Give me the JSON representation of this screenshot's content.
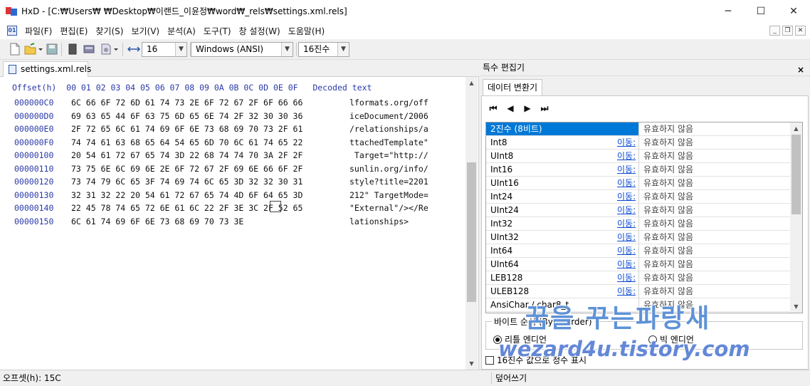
{
  "window": {
    "app_name": "HxD",
    "title": "HxD - [C:₩Users₩     ₩Desktop₩이랜드_이윤정₩word₩_rels₩settings.xml.rels]",
    "minimize": "─",
    "maximize": "☐",
    "close": "✕"
  },
  "menu": {
    "items": [
      "파일(F)",
      "편집(E)",
      "찾기(S)",
      "보기(V)",
      "분석(A)",
      "도구(T)",
      "창 설정(W)",
      "도움말(H)"
    ]
  },
  "toolbar": {
    "bytes_per_row": "16",
    "charset": "Windows (ANSI)",
    "offset_base": "16진수"
  },
  "document": {
    "tab_label": "settings.xml.rels",
    "header": "Offset(h)  00 01 02 03 04 05 06 07 08 09 0A 0B 0C 0D 0E 0F   Decoded text",
    "rows": [
      {
        "offset": "000000C0",
        "hex": "6C 66 6F 72 6D 61 74 73 2E 6F 72 67 2F 6F 66 66",
        "text": "lformats.org/off"
      },
      {
        "offset": "000000D0",
        "hex": "69 63 65 44 6F 63 75 6D 65 6E 74 2F 32 30 30 36",
        "text": "iceDocument/2006"
      },
      {
        "offset": "000000E0",
        "hex": "2F 72 65 6C 61 74 69 6F 6E 73 68 69 70 73 2F 61",
        "text": "/relationships/a"
      },
      {
        "offset": "000000F0",
        "hex": "74 74 61 63 68 65 64 54 65 6D 70 6C 61 74 65 22",
        "text": "ttachedTemplate\""
      },
      {
        "offset": "00000100",
        "hex": "20 54 61 72 67 65 74 3D 22 68 74 74 70 3A 2F 2F",
        "text": " Target=\"http://"
      },
      {
        "offset": "00000110",
        "hex": "73 75 6E 6C 69 6E 2E 6F 72 67 2F 69 6E 66 6F 2F",
        "text": "sunlin.org/info/"
      },
      {
        "offset": "00000120",
        "hex": "73 74 79 6C 65 3F 74 69 74 6C 65 3D 32 32 30 31",
        "text": "style?title=2201"
      },
      {
        "offset": "00000130",
        "hex": "32 31 32 22 20 54 61 72 67 65 74 4D 6F 64 65 3D",
        "text": "212\" TargetMode="
      },
      {
        "offset": "00000140",
        "hex": "22 45 78 74 65 72 6E 61 6C 22 2F 3E 3C 2F 52 65",
        "text": "\"External\"/></Re"
      },
      {
        "offset": "00000150",
        "hex": "6C 61 74 69 6F 6E 73 68 69 70 73 3E",
        "text": "lationships>"
      }
    ]
  },
  "side_panel": {
    "title": "특수 편집기",
    "close": "×",
    "tab": "데이터 변환기",
    "nav": [
      "⏮",
      "◀",
      "▶",
      "⏭"
    ],
    "goto_label": "이동:",
    "rows": [
      {
        "type": "2진수 (8비트)",
        "value": "유효하지 않음",
        "goto": false,
        "selected": true
      },
      {
        "type": "Int8",
        "value": "유효하지 않음",
        "goto": true
      },
      {
        "type": "UInt8",
        "value": "유효하지 않음",
        "goto": true
      },
      {
        "type": "Int16",
        "value": "유효하지 않음",
        "goto": true
      },
      {
        "type": "UInt16",
        "value": "유효하지 않음",
        "goto": true
      },
      {
        "type": "Int24",
        "value": "유효하지 않음",
        "goto": true
      },
      {
        "type": "UInt24",
        "value": "유효하지 않음",
        "goto": true
      },
      {
        "type": "Int32",
        "value": "유효하지 않음",
        "goto": true
      },
      {
        "type": "UInt32",
        "value": "유효하지 않음",
        "goto": true
      },
      {
        "type": "Int64",
        "value": "유효하지 않음",
        "goto": true
      },
      {
        "type": "UInt64",
        "value": "유효하지 않음",
        "goto": true
      },
      {
        "type": "LEB128",
        "value": "유효하지 않음",
        "goto": true
      },
      {
        "type": "ULEB128",
        "value": "유효하지 않음",
        "goto": true
      },
      {
        "type": "AnsiChar / char8_t",
        "value": "유효하지 않음",
        "goto": false
      }
    ],
    "byte_order": {
      "legend": "바이트 순서 (Byte Order)",
      "little": "리틀 엔디언",
      "big": "빅 엔디언",
      "selected": "little"
    },
    "hex_checkbox": "16진수 값으로 정수 표시"
  },
  "status": {
    "offset": "오프셋(h): 15C",
    "mode": "덮어쓰기"
  },
  "watermark": {
    "line1": "꿈을 꾸는파랑새",
    "line2": "wezard4u.tistory.com"
  }
}
